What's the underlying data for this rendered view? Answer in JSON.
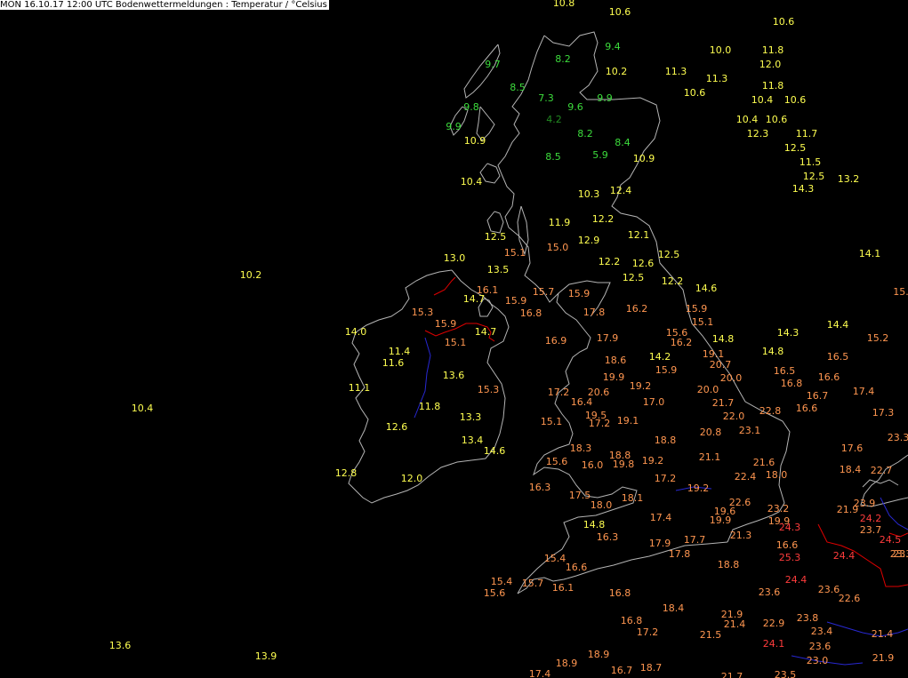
{
  "title": "MON 16.10.17 12:00 UTC  Bodenwettermeldungen :  Temperatur / °Celsius",
  "colors": {
    "background": "#000000",
    "coast": "#b4b4b4",
    "border": "#2828d2",
    "isotherm_15": "#e00000",
    "cold": "#3cdc3c",
    "very_cold": "#228b22",
    "mild": "#ffff50",
    "warm": "#ff9650",
    "hot": "#ff3c3c"
  },
  "observations": [
    {
      "v": "10.8"
    },
    {
      "v": "10.6"
    },
    {
      "v": "10.6"
    },
    {
      "v": "9.4"
    },
    {
      "v": "10.0"
    },
    {
      "v": "11.8"
    },
    {
      "v": "8.2"
    },
    {
      "v": "9.7"
    },
    {
      "v": "12.0"
    },
    {
      "v": "10.2"
    },
    {
      "v": "11.3"
    },
    {
      "v": "11.3"
    },
    {
      "v": "8.5"
    },
    {
      "v": "10.6"
    },
    {
      "v": "11.8"
    },
    {
      "v": "7.3"
    },
    {
      "v": "9.9"
    },
    {
      "v": "10.4"
    },
    {
      "v": "10.6"
    },
    {
      "v": "9.8"
    },
    {
      "v": "9.6"
    },
    {
      "v": "4.2"
    },
    {
      "v": "10.4"
    },
    {
      "v": "10.6"
    },
    {
      "v": "9.9"
    },
    {
      "v": "8.2"
    },
    {
      "v": "12.3"
    },
    {
      "v": "11.7"
    },
    {
      "v": "10.9"
    },
    {
      "v": "8.4"
    },
    {
      "v": "12.5"
    },
    {
      "v": "8.5"
    },
    {
      "v": "5.9"
    },
    {
      "v": "10.9"
    },
    {
      "v": "11.5"
    },
    {
      "v": "10.4"
    },
    {
      "v": "12.5"
    },
    {
      "v": "13.2"
    },
    {
      "v": "12.4"
    },
    {
      "v": "14.3"
    },
    {
      "v": "10.3"
    },
    {
      "v": "12.2"
    },
    {
      "v": "11.9"
    },
    {
      "v": "12.5"
    },
    {
      "v": "12.9"
    },
    {
      "v": "12.1"
    },
    {
      "v": "15.0"
    },
    {
      "v": "15.1"
    },
    {
      "v": "12.5"
    },
    {
      "v": "14.1"
    },
    {
      "v": "13.0"
    },
    {
      "v": "12.2"
    },
    {
      "v": "12.6"
    },
    {
      "v": "13.5"
    },
    {
      "v": "10.2"
    },
    {
      "v": "12.5"
    },
    {
      "v": "12.2"
    },
    {
      "v": "14.6"
    },
    {
      "v": "16.1"
    },
    {
      "v": "15.7"
    },
    {
      "v": "15.9"
    },
    {
      "v": "15."
    },
    {
      "v": "14.7"
    },
    {
      "v": "15.9"
    },
    {
      "v": "16.8"
    },
    {
      "v": "17.8"
    },
    {
      "v": "16.2"
    },
    {
      "v": "15.9"
    },
    {
      "v": "15.3"
    },
    {
      "v": "15.1"
    },
    {
      "v": "15.9"
    },
    {
      "v": "14.4"
    },
    {
      "v": "14.0"
    },
    {
      "v": "14.7"
    },
    {
      "v": "15.1"
    },
    {
      "v": "16.9"
    },
    {
      "v": "17.9"
    },
    {
      "v": "15.6"
    },
    {
      "v": "14.3"
    },
    {
      "v": "16.2"
    },
    {
      "v": "14.8"
    },
    {
      "v": "15.2"
    },
    {
      "v": "11.4"
    },
    {
      "v": "14.8"
    },
    {
      "v": "14.2"
    },
    {
      "v": "19.1"
    },
    {
      "v": "11.6"
    },
    {
      "v": "18.6"
    },
    {
      "v": "16.5"
    },
    {
      "v": "20.7"
    },
    {
      "v": "16.5"
    },
    {
      "v": "15.9"
    },
    {
      "v": "13.6"
    },
    {
      "v": "20.0"
    },
    {
      "v": "19.9"
    },
    {
      "v": "16.6"
    },
    {
      "v": "11.1"
    },
    {
      "v": "16.8"
    },
    {
      "v": "15.3"
    },
    {
      "v": "19.2"
    },
    {
      "v": "17.2"
    },
    {
      "v": "20.6"
    },
    {
      "v": "20.0"
    },
    {
      "v": "17.4"
    },
    {
      "v": "16.7"
    },
    {
      "v": "17.0"
    },
    {
      "v": "16.4"
    },
    {
      "v": "21.7"
    },
    {
      "v": "10.4"
    },
    {
      "v": "11.8"
    },
    {
      "v": "16.6"
    },
    {
      "v": "22.8"
    },
    {
      "v": "19.5"
    },
    {
      "v": "17.3"
    },
    {
      "v": "13.3"
    },
    {
      "v": "22.0"
    },
    {
      "v": "15.1"
    },
    {
      "v": "17.2"
    },
    {
      "v": "19.1"
    },
    {
      "v": "23.1"
    },
    {
      "v": "12.6"
    },
    {
      "v": "20.8"
    },
    {
      "v": "13.4"
    },
    {
      "v": "18.8"
    },
    {
      "v": "23.3"
    },
    {
      "v": "18.3"
    },
    {
      "v": "14.6"
    },
    {
      "v": "17.6"
    },
    {
      "v": "18.8"
    },
    {
      "v": "21.1"
    },
    {
      "v": "15.6"
    },
    {
      "v": "19.2"
    },
    {
      "v": "21.6"
    },
    {
      "v": "16.0"
    },
    {
      "v": "19.8"
    },
    {
      "v": "18.4"
    },
    {
      "v": "22.7"
    },
    {
      "v": "12.8"
    },
    {
      "v": "18.0"
    },
    {
      "v": "17.2"
    },
    {
      "v": "22.4"
    },
    {
      "v": "12.0"
    },
    {
      "v": "16.3"
    },
    {
      "v": "19.2"
    },
    {
      "v": "17.5"
    },
    {
      "v": "18.1"
    },
    {
      "v": "22.6"
    },
    {
      "v": "23.9"
    },
    {
      "v": "18.0"
    },
    {
      "v": "19.6"
    },
    {
      "v": "23.2"
    },
    {
      "v": "21.9"
    },
    {
      "v": "17.4"
    },
    {
      "v": "24.2"
    },
    {
      "v": "19.9"
    },
    {
      "v": "19.9"
    },
    {
      "v": "14.8"
    },
    {
      "v": "23.7"
    },
    {
      "v": "24.3"
    },
    {
      "v": "16.3"
    },
    {
      "v": "21.3"
    },
    {
      "v": "17.9"
    },
    {
      "v": "17.7"
    },
    {
      "v": "24.5"
    },
    {
      "v": "23.3"
    },
    {
      "v": "17.8"
    },
    {
      "v": "15.4"
    },
    {
      "v": "16.6"
    },
    {
      "v": "16.6"
    },
    {
      "v": "25.3"
    },
    {
      "v": "24.4"
    },
    {
      "v": "23."
    },
    {
      "v": "18.8"
    },
    {
      "v": "15.4"
    },
    {
      "v": "15.7"
    },
    {
      "v": "24.4"
    },
    {
      "v": "16.1"
    },
    {
      "v": "23.6"
    },
    {
      "v": "15.6"
    },
    {
      "v": "16.8"
    },
    {
      "v": "23.6"
    },
    {
      "v": "22.6"
    },
    {
      "v": "18.4"
    },
    {
      "v": "21.9"
    },
    {
      "v": "16.8"
    },
    {
      "v": "23.8"
    },
    {
      "v": "21.4"
    },
    {
      "v": "22.9"
    },
    {
      "v": "17.2"
    },
    {
      "v": "23.4"
    },
    {
      "v": "21.5"
    },
    {
      "v": "21.4"
    },
    {
      "v": "13.6"
    },
    {
      "v": "24.1"
    },
    {
      "v": "23.6"
    },
    {
      "v": "13.9"
    },
    {
      "v": "18.9"
    },
    {
      "v": "18.9"
    },
    {
      "v": "23.0"
    },
    {
      "v": "21.9"
    },
    {
      "v": "18.7"
    },
    {
      "v": "16.7"
    },
    {
      "v": "17.4"
    },
    {
      "v": "21.7"
    },
    {
      "v": "23.5"
    }
  ]
}
